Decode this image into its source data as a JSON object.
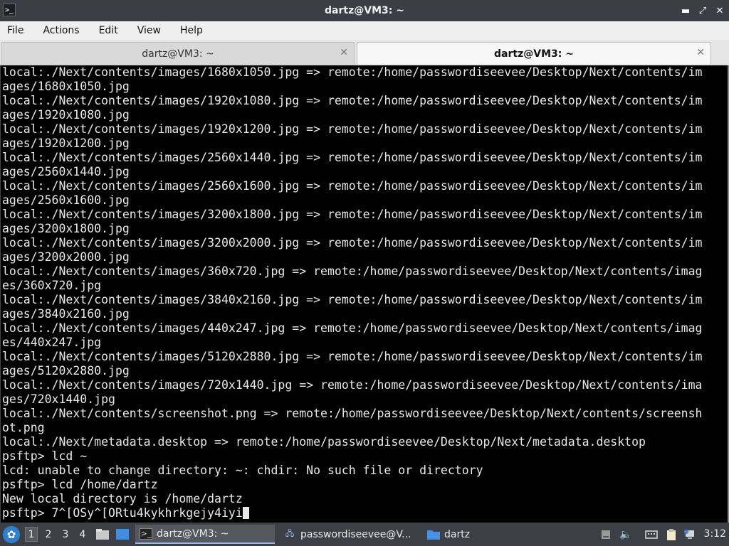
{
  "window": {
    "title": "dartz@VM3: ~",
    "icon": "terminal-icon",
    "controls": [
      "minimize-icon",
      "restore-icon",
      "close-icon"
    ]
  },
  "menu": [
    "File",
    "Actions",
    "Edit",
    "View",
    "Help"
  ],
  "tabs": [
    {
      "label": "dartz@VM3: ~",
      "active": false
    },
    {
      "label": "dartz@VM3: ~",
      "active": true
    }
  ],
  "terminal": {
    "lines": [
      "local:./Next/contents/images/1680x1050.jpg => remote:/home/passwordiseevee/Desktop/Next/contents/im",
      "ages/1680x1050.jpg",
      "local:./Next/contents/images/1920x1080.jpg => remote:/home/passwordiseevee/Desktop/Next/contents/im",
      "ages/1920x1080.jpg",
      "local:./Next/contents/images/1920x1200.jpg => remote:/home/passwordiseevee/Desktop/Next/contents/im",
      "ages/1920x1200.jpg",
      "local:./Next/contents/images/2560x1440.jpg => remote:/home/passwordiseevee/Desktop/Next/contents/im",
      "ages/2560x1440.jpg",
      "local:./Next/contents/images/2560x1600.jpg => remote:/home/passwordiseevee/Desktop/Next/contents/im",
      "ages/2560x1600.jpg",
      "local:./Next/contents/images/3200x1800.jpg => remote:/home/passwordiseevee/Desktop/Next/contents/im",
      "ages/3200x1800.jpg",
      "local:./Next/contents/images/3200x2000.jpg => remote:/home/passwordiseevee/Desktop/Next/contents/im",
      "ages/3200x2000.jpg",
      "local:./Next/contents/images/360x720.jpg => remote:/home/passwordiseevee/Desktop/Next/contents/imag",
      "es/360x720.jpg",
      "local:./Next/contents/images/3840x2160.jpg => remote:/home/passwordiseevee/Desktop/Next/contents/im",
      "ages/3840x2160.jpg",
      "local:./Next/contents/images/440x247.jpg => remote:/home/passwordiseevee/Desktop/Next/contents/imag",
      "es/440x247.jpg",
      "local:./Next/contents/images/5120x2880.jpg => remote:/home/passwordiseevee/Desktop/Next/contents/im",
      "ages/5120x2880.jpg",
      "local:./Next/contents/images/720x1440.jpg => remote:/home/passwordiseevee/Desktop/Next/contents/ima",
      "ges/720x1440.jpg",
      "local:./Next/contents/screenshot.png => remote:/home/passwordiseevee/Desktop/Next/contents/screensh",
      "ot.png",
      "local:./Next/metadata.desktop => remote:/home/passwordiseevee/Desktop/Next/metadata.desktop",
      "psftp> lcd ~",
      "lcd: unable to change directory: ~: chdir: No such file or directory",
      "psftp> lcd /home/dartz",
      "New local directory is /home/dartz",
      "psftp> 7^[OSy^[ORtu4kykhrkgejy4iyi"
    ]
  },
  "taskbar": {
    "start_icon": "start-menu-icon",
    "workspaces": [
      "1",
      "2",
      "3",
      "4"
    ],
    "active_workspace": "1",
    "quick_launch": [
      "file-manager-icon",
      "show-desktop-icon"
    ],
    "tasks": [
      {
        "label": "dartz@VM3: ~",
        "icon": "terminal-icon",
        "active": true
      },
      {
        "label": "passwordiseevee@V...",
        "icon": "network-terminal-icon",
        "active": false
      },
      {
        "label": "dartz",
        "icon": "folder-icon",
        "active": false
      }
    ],
    "tray": [
      "removable-drive-icon",
      "volume-icon",
      "keyboard-icon",
      "clipboard-icon",
      "network-icon"
    ],
    "clock": "3:12"
  }
}
